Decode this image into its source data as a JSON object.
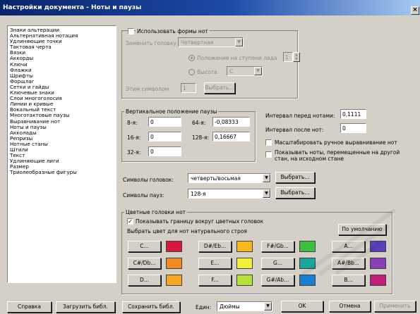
{
  "window": {
    "title": "Настройки документа - Ноты и паузы",
    "close_glyph": "×"
  },
  "list": {
    "selected_index": 26,
    "items": [
      "Знаки альтерации",
      "Альтернативная нотация",
      "Удлиняющие точки",
      "Тактовая черта",
      "Вязки",
      "Аккорды",
      "Ключи",
      "Флажки",
      "Шрифты",
      "Форшлаг",
      "Сетки и гайды",
      "Ключевые знаки",
      "Слои многоголосия",
      "Линии и кривые",
      "Вокальный текст",
      "Многотактовые паузы",
      "Выравнивание нот",
      "Ноты и паузы",
      "Акколады",
      "Репризы",
      "Нотные станы",
      "Штили",
      "Текст",
      "Удлиняющие лиги",
      "Размер",
      "Триолеобразные фигуры"
    ]
  },
  "shapes": {
    "use_label": "Использовать формы нот",
    "replace_label": "Заменить головку",
    "replace_value": "Четвертная",
    "pos_label": "Положение на ступени лада",
    "pos_value": "1",
    "height_label": "Высота",
    "height_value": "C",
    "symbol_label": "Этим символом",
    "symbol_value": "1",
    "choose_label": "Выбрать..."
  },
  "vertical": {
    "title": "Вертикальное положение паузы",
    "r8_label": "8-я:",
    "r8_value": "0",
    "r64_label": "64-я:",
    "r64_value": "-0,08333",
    "r16_label": "16-я:",
    "r16_value": "0",
    "r128_label": "128-я:",
    "r128_value": "0,16667",
    "r32_label": "32-я:",
    "r32_value": "0"
  },
  "intervals": {
    "before_label": "Интервал перед нотами:",
    "before_value": "0,1111",
    "after_label": "Интервал после нот:",
    "after_value": "0",
    "scale_label": "Масштабировать ручное выравнивание нот",
    "show_moved_label": "Показывать ноты, перемещенные на другой стан, на исходном стане"
  },
  "symbols": {
    "head_label": "Символы головок:",
    "head_value": "четверть/восьмая",
    "rest_label": "Символы пауз:",
    "rest_value": "128-я",
    "choose_label": "Выбрать..."
  },
  "colored": {
    "title": "Цветные головки нот",
    "border_label": "Показывать границу вокруг цветных головок",
    "pick_label": "Выбрать цвет для нот натурального строя",
    "default_label": "По умолчанию",
    "notes": [
      {
        "label": "C...",
        "color": "#d8173f"
      },
      {
        "label": "D#/Eb...",
        "color": "#f5b81e"
      },
      {
        "label": "F#/Gb...",
        "color": "#3fbf3f"
      },
      {
        "label": "A...",
        "color": "#5a3fbf"
      },
      {
        "label": "C#/Db...",
        "color": "#f08a22"
      },
      {
        "label": "E...",
        "color": "#f2ef3a"
      },
      {
        "label": "G...",
        "color": "#1aa59e"
      },
      {
        "label": "A#/Bb...",
        "color": "#8a3fb8"
      },
      {
        "label": "D...",
        "color": "#f5a623"
      },
      {
        "label": "F...",
        "color": "#b8e03a"
      },
      {
        "label": "G#/Ab...",
        "color": "#1a7fd0"
      },
      {
        "label": "B...",
        "color": "#c21f7a"
      }
    ]
  },
  "bottom": {
    "help": "Справка",
    "load": "Загрузить библ.",
    "save": "Сохранить библ.",
    "units_label": "Един:",
    "units_value": "Дюймы",
    "ok": "OK",
    "cancel": "Отмена",
    "apply": "Применить"
  }
}
